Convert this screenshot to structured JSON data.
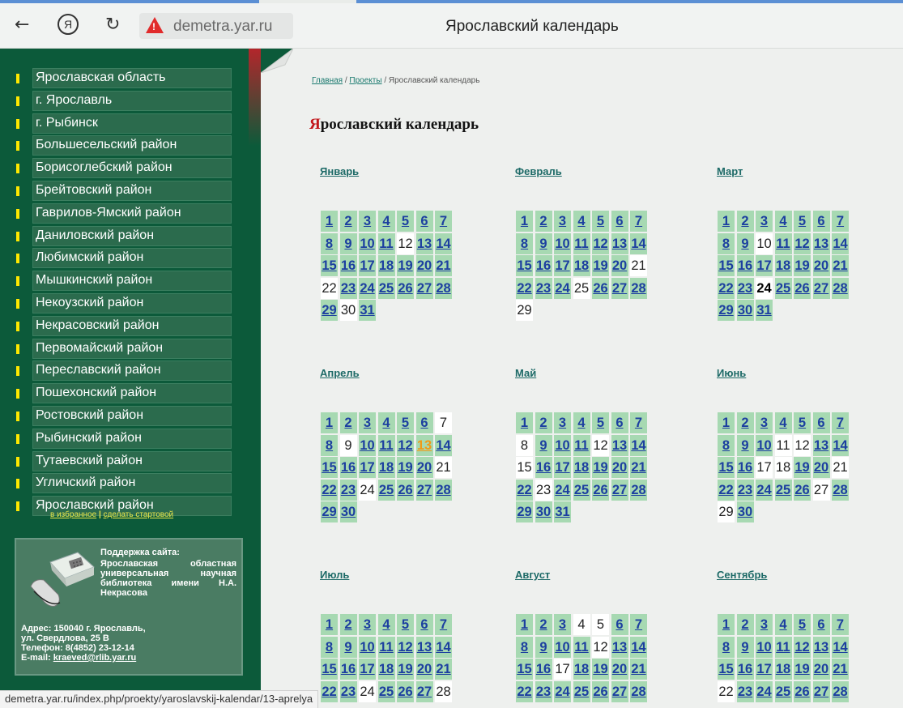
{
  "browser": {
    "url": "demetra.yar.ru",
    "title": "Ярославский календарь"
  },
  "sidebar": {
    "items": [
      "Ярославская область",
      "г. Ярославль",
      "г. Рыбинск",
      "Большесельский район",
      "Борисоглебский район",
      "Брейтовский район",
      "Гаврилов-Ямский район",
      "Даниловский район",
      "Любимский район",
      "Мышкинский район",
      "Некоузский район",
      "Некрасовский район",
      "Первомайский район",
      "Переславский район",
      "Пошехонский район",
      "Ростовский район",
      "Рыбинский район",
      "Тутаевский район",
      "Угличский район",
      "Ярославский район"
    ],
    "favorites_link": "в избранное",
    "separator": "|",
    "homepage_link": "сделать стартовой",
    "support": {
      "title": "Поддержка сайта:",
      "text": "Ярославская областная универсальная научная библиотека имени Н.А. Некрасова",
      "address_line1": "Адрес: 150040 г. Ярославль,",
      "address_line2": "ул. Свердлова, 25 В",
      "phone": "Телефон: 8(4852) 23-12-14",
      "email_label": "E-mail:",
      "email": "kraeved@rlib.yar.ru"
    }
  },
  "breadcrumb": {
    "home": "Главная",
    "sep1": " / ",
    "projects": "Проекты",
    "sep2": " / ",
    "current": "Ярославский календарь"
  },
  "heading": {
    "first_letter": "Я",
    "rest": "рославский календарь"
  },
  "months": [
    {
      "name": "Январь",
      "rows": [
        [
          [
            "1",
            "l"
          ],
          [
            "2",
            "l"
          ],
          [
            "3",
            "l"
          ],
          [
            "4",
            "l"
          ],
          [
            "5",
            "l"
          ],
          [
            "6",
            "l"
          ],
          [
            "7",
            "l"
          ]
        ],
        [
          [
            "8",
            "l"
          ],
          [
            "9",
            "l"
          ],
          [
            "10",
            "l"
          ],
          [
            "11",
            "l"
          ],
          [
            "12",
            "p"
          ],
          [
            "13",
            "l"
          ],
          [
            "14",
            "l"
          ]
        ],
        [
          [
            "15",
            "l"
          ],
          [
            "16",
            "l"
          ],
          [
            "17",
            "l"
          ],
          [
            "18",
            "l"
          ],
          [
            "19",
            "l"
          ],
          [
            "20",
            "l"
          ],
          [
            "21",
            "l"
          ]
        ],
        [
          [
            "22",
            "p"
          ],
          [
            "23",
            "l"
          ],
          [
            "24",
            "l"
          ],
          [
            "25",
            "l"
          ],
          [
            "26",
            "l"
          ],
          [
            "27",
            "l"
          ],
          [
            "28",
            "l"
          ]
        ],
        [
          [
            "29",
            "l"
          ],
          [
            "30",
            "p"
          ],
          [
            "31",
            "l"
          ]
        ]
      ]
    },
    {
      "name": "Февраль",
      "rows": [
        [
          [
            "1",
            "l"
          ],
          [
            "2",
            "l"
          ],
          [
            "3",
            "l"
          ],
          [
            "4",
            "l"
          ],
          [
            "5",
            "l"
          ],
          [
            "6",
            "l"
          ],
          [
            "7",
            "l"
          ]
        ],
        [
          [
            "8",
            "l"
          ],
          [
            "9",
            "l"
          ],
          [
            "10",
            "l"
          ],
          [
            "11",
            "l"
          ],
          [
            "12",
            "l"
          ],
          [
            "13",
            "l"
          ],
          [
            "14",
            "l"
          ]
        ],
        [
          [
            "15",
            "l"
          ],
          [
            "16",
            "l"
          ],
          [
            "17",
            "l"
          ],
          [
            "18",
            "l"
          ],
          [
            "19",
            "l"
          ],
          [
            "20",
            "l"
          ],
          [
            "21",
            "p"
          ]
        ],
        [
          [
            "22",
            "l"
          ],
          [
            "23",
            "l"
          ],
          [
            "24",
            "l"
          ],
          [
            "25",
            "p"
          ],
          [
            "26",
            "l"
          ],
          [
            "27",
            "l"
          ],
          [
            "28",
            "l"
          ]
        ],
        [
          [
            "29",
            "p"
          ]
        ]
      ]
    },
    {
      "name": "Март",
      "rows": [
        [
          [
            "1",
            "l"
          ],
          [
            "2",
            "l"
          ],
          [
            "3",
            "l"
          ],
          [
            "4",
            "l"
          ],
          [
            "5",
            "l"
          ],
          [
            "6",
            "l"
          ],
          [
            "7",
            "l"
          ]
        ],
        [
          [
            "8",
            "l"
          ],
          [
            "9",
            "l"
          ],
          [
            "10",
            "p"
          ],
          [
            "11",
            "l"
          ],
          [
            "12",
            "l"
          ],
          [
            "13",
            "l"
          ],
          [
            "14",
            "l"
          ]
        ],
        [
          [
            "15",
            "l"
          ],
          [
            "16",
            "l"
          ],
          [
            "17",
            "l"
          ],
          [
            "18",
            "l"
          ],
          [
            "19",
            "l"
          ],
          [
            "20",
            "l"
          ],
          [
            "21",
            "l"
          ]
        ],
        [
          [
            "22",
            "l"
          ],
          [
            "23",
            "l"
          ],
          [
            "24",
            "t"
          ],
          [
            "25",
            "l"
          ],
          [
            "26",
            "l"
          ],
          [
            "27",
            "l"
          ],
          [
            "28",
            "l"
          ]
        ],
        [
          [
            "29",
            "l"
          ],
          [
            "30",
            "l"
          ],
          [
            "31",
            "l"
          ]
        ]
      ]
    },
    {
      "name": "Апрель",
      "rows": [
        [
          [
            "1",
            "l"
          ],
          [
            "2",
            "l"
          ],
          [
            "3",
            "l"
          ],
          [
            "4",
            "l"
          ],
          [
            "5",
            "l"
          ],
          [
            "6",
            "l"
          ],
          [
            "7",
            "p"
          ]
        ],
        [
          [
            "8",
            "l"
          ],
          [
            "9",
            "p"
          ],
          [
            "10",
            "l"
          ],
          [
            "11",
            "l"
          ],
          [
            "12",
            "l"
          ],
          [
            "13",
            "o"
          ],
          [
            "14",
            "l"
          ]
        ],
        [
          [
            "15",
            "l"
          ],
          [
            "16",
            "l"
          ],
          [
            "17",
            "l"
          ],
          [
            "18",
            "l"
          ],
          [
            "19",
            "l"
          ],
          [
            "20",
            "l"
          ],
          [
            "21",
            "p"
          ]
        ],
        [
          [
            "22",
            "l"
          ],
          [
            "23",
            "l"
          ],
          [
            "24",
            "p"
          ],
          [
            "25",
            "l"
          ],
          [
            "26",
            "l"
          ],
          [
            "27",
            "l"
          ],
          [
            "28",
            "l"
          ]
        ],
        [
          [
            "29",
            "l"
          ],
          [
            "30",
            "l"
          ]
        ]
      ]
    },
    {
      "name": "Май",
      "rows": [
        [
          [
            "1",
            "l"
          ],
          [
            "2",
            "l"
          ],
          [
            "3",
            "l"
          ],
          [
            "4",
            "l"
          ],
          [
            "5",
            "l"
          ],
          [
            "6",
            "l"
          ],
          [
            "7",
            "l"
          ]
        ],
        [
          [
            "8",
            "p"
          ],
          [
            "9",
            "l"
          ],
          [
            "10",
            "l"
          ],
          [
            "11",
            "l"
          ],
          [
            "12",
            "p"
          ],
          [
            "13",
            "l"
          ],
          [
            "14",
            "l"
          ]
        ],
        [
          [
            "15",
            "p"
          ],
          [
            "16",
            "l"
          ],
          [
            "17",
            "l"
          ],
          [
            "18",
            "l"
          ],
          [
            "19",
            "l"
          ],
          [
            "20",
            "l"
          ],
          [
            "21",
            "l"
          ]
        ],
        [
          [
            "22",
            "l"
          ],
          [
            "23",
            "p"
          ],
          [
            "24",
            "l"
          ],
          [
            "25",
            "l"
          ],
          [
            "26",
            "l"
          ],
          [
            "27",
            "l"
          ],
          [
            "28",
            "l"
          ]
        ],
        [
          [
            "29",
            "l"
          ],
          [
            "30",
            "l"
          ],
          [
            "31",
            "l"
          ]
        ]
      ]
    },
    {
      "name": "Июнь",
      "rows": [
        [
          [
            "1",
            "l"
          ],
          [
            "2",
            "l"
          ],
          [
            "3",
            "l"
          ],
          [
            "4",
            "l"
          ],
          [
            "5",
            "l"
          ],
          [
            "6",
            "l"
          ],
          [
            "7",
            "l"
          ]
        ],
        [
          [
            "8",
            "l"
          ],
          [
            "9",
            "l"
          ],
          [
            "10",
            "l"
          ],
          [
            "11",
            "p"
          ],
          [
            "12",
            "p"
          ],
          [
            "13",
            "l"
          ],
          [
            "14",
            "l"
          ]
        ],
        [
          [
            "15",
            "l"
          ],
          [
            "16",
            "l"
          ],
          [
            "17",
            "p"
          ],
          [
            "18",
            "p"
          ],
          [
            "19",
            "l"
          ],
          [
            "20",
            "l"
          ],
          [
            "21",
            "p"
          ]
        ],
        [
          [
            "22",
            "l"
          ],
          [
            "23",
            "l"
          ],
          [
            "24",
            "l"
          ],
          [
            "25",
            "l"
          ],
          [
            "26",
            "l"
          ],
          [
            "27",
            "p"
          ],
          [
            "28",
            "l"
          ]
        ],
        [
          [
            "29",
            "p"
          ],
          [
            "30",
            "l"
          ]
        ]
      ]
    },
    {
      "name": "Июль",
      "rows": [
        [
          [
            "1",
            "l"
          ],
          [
            "2",
            "l"
          ],
          [
            "3",
            "l"
          ],
          [
            "4",
            "l"
          ],
          [
            "5",
            "l"
          ],
          [
            "6",
            "l"
          ],
          [
            "7",
            "l"
          ]
        ],
        [
          [
            "8",
            "l"
          ],
          [
            "9",
            "l"
          ],
          [
            "10",
            "l"
          ],
          [
            "11",
            "l"
          ],
          [
            "12",
            "l"
          ],
          [
            "13",
            "l"
          ],
          [
            "14",
            "l"
          ]
        ],
        [
          [
            "15",
            "l"
          ],
          [
            "16",
            "l"
          ],
          [
            "17",
            "l"
          ],
          [
            "18",
            "l"
          ],
          [
            "19",
            "l"
          ],
          [
            "20",
            "l"
          ],
          [
            "21",
            "l"
          ]
        ],
        [
          [
            "22",
            "l"
          ],
          [
            "23",
            "l"
          ],
          [
            "24",
            "p"
          ],
          [
            "25",
            "l"
          ],
          [
            "26",
            "l"
          ],
          [
            "27",
            "l"
          ],
          [
            "28",
            "p"
          ]
        ]
      ]
    },
    {
      "name": "Август",
      "rows": [
        [
          [
            "1",
            "l"
          ],
          [
            "2",
            "l"
          ],
          [
            "3",
            "l"
          ],
          [
            "4",
            "p"
          ],
          [
            "5",
            "p"
          ],
          [
            "6",
            "l"
          ],
          [
            "7",
            "l"
          ]
        ],
        [
          [
            "8",
            "l"
          ],
          [
            "9",
            "l"
          ],
          [
            "10",
            "l"
          ],
          [
            "11",
            "l"
          ],
          [
            "12",
            "p"
          ],
          [
            "13",
            "l"
          ],
          [
            "14",
            "l"
          ]
        ],
        [
          [
            "15",
            "l"
          ],
          [
            "16",
            "l"
          ],
          [
            "17",
            "p"
          ],
          [
            "18",
            "l"
          ],
          [
            "19",
            "l"
          ],
          [
            "20",
            "l"
          ],
          [
            "21",
            "l"
          ]
        ],
        [
          [
            "22",
            "l"
          ],
          [
            "23",
            "l"
          ],
          [
            "24",
            "l"
          ],
          [
            "25",
            "l"
          ],
          [
            "26",
            "l"
          ],
          [
            "27",
            "l"
          ],
          [
            "28",
            "l"
          ]
        ]
      ]
    },
    {
      "name": "Сентябрь",
      "rows": [
        [
          [
            "1",
            "l"
          ],
          [
            "2",
            "l"
          ],
          [
            "3",
            "l"
          ],
          [
            "4",
            "l"
          ],
          [
            "5",
            "l"
          ],
          [
            "6",
            "l"
          ],
          [
            "7",
            "l"
          ]
        ],
        [
          [
            "8",
            "l"
          ],
          [
            "9",
            "l"
          ],
          [
            "10",
            "l"
          ],
          [
            "11",
            "l"
          ],
          [
            "12",
            "l"
          ],
          [
            "13",
            "l"
          ],
          [
            "14",
            "l"
          ]
        ],
        [
          [
            "15",
            "l"
          ],
          [
            "16",
            "l"
          ],
          [
            "17",
            "l"
          ],
          [
            "18",
            "l"
          ],
          [
            "19",
            "l"
          ],
          [
            "20",
            "l"
          ],
          [
            "21",
            "l"
          ]
        ],
        [
          [
            "22",
            "p"
          ],
          [
            "23",
            "l"
          ],
          [
            "24",
            "l"
          ],
          [
            "25",
            "l"
          ],
          [
            "26",
            "l"
          ],
          [
            "27",
            "l"
          ],
          [
            "28",
            "l"
          ]
        ]
      ]
    }
  ],
  "status_url": "demetra.yar.ru/index.php/proekty/yaroslavskij-kalendar/13-aprelya"
}
